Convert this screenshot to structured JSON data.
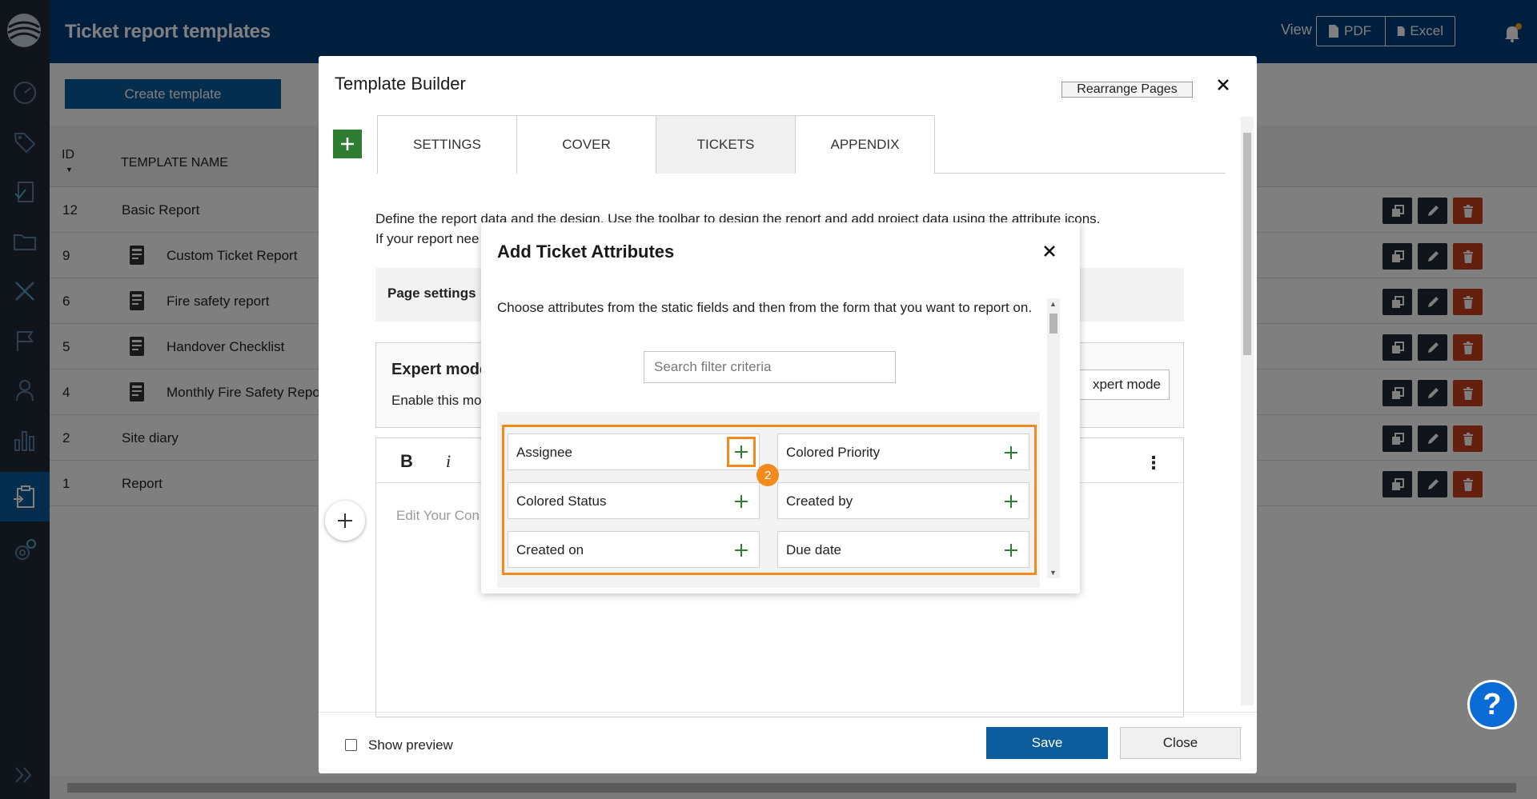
{
  "header": {
    "title": "Ticket report templates",
    "view_label": "View",
    "pdf_label": "PDF",
    "excel_label": "Excel"
  },
  "page": {
    "create_button": "Create template",
    "columns": {
      "id": "ID",
      "name": "TEMPLATE NAME"
    },
    "rows": [
      {
        "id": "12",
        "name": "Basic Report",
        "has_icon": false
      },
      {
        "id": "9",
        "name": "Custom Ticket Report",
        "has_icon": true
      },
      {
        "id": "6",
        "name": "Fire safety report",
        "has_icon": true
      },
      {
        "id": "5",
        "name": "Handover Checklist",
        "has_icon": true
      },
      {
        "id": "4",
        "name": "Monthly Fire Safety Repo",
        "has_icon": true
      },
      {
        "id": "2",
        "name": "Site diary",
        "has_icon": false
      },
      {
        "id": "1",
        "name": "Report",
        "has_icon": false
      }
    ]
  },
  "builder": {
    "title": "Template Builder",
    "rearrange_label": "Rearrange Pages",
    "tabs": [
      {
        "label": "SETTINGS",
        "active": false
      },
      {
        "label": "COVER",
        "active": false
      },
      {
        "label": "TICKETS",
        "active": true
      },
      {
        "label": "APPENDIX",
        "active": false
      }
    ],
    "desc_line1": "Define the report data and the design. Use the toolbar to design the report and add project data using the attribute icons.",
    "desc_line2": "If your report nee",
    "page_settings": "Page settings",
    "expert_title": "Expert mode",
    "expert_desc": "Enable this mo",
    "expert_button": "xpert mode",
    "editor_bold": "B",
    "editor_italic": "i",
    "editor_placeholder": "Edit Your Con",
    "show_preview": "Show preview",
    "save_label": "Save",
    "close_label": "Close"
  },
  "attributes_modal": {
    "title": "Add Ticket Attributes",
    "description": "Choose attributes from the static fields and then from the form that you want to report on.",
    "search_placeholder": "Search filter criteria",
    "step_number": "2",
    "attributes": [
      {
        "label": "Assignee",
        "highlighted": true
      },
      {
        "label": "Colored Priority",
        "highlighted": false
      },
      {
        "label": "Colored Status",
        "highlighted": false
      },
      {
        "label": "Created by",
        "highlighted": false
      },
      {
        "label": "Created on",
        "highlighted": false
      },
      {
        "label": "Due date",
        "highlighted": false
      }
    ]
  },
  "help_label": "?",
  "colors": {
    "header_bg": "#003f7f",
    "sidebar_bg": "#1f2a35",
    "primary": "#0b5c9c",
    "add_green": "#2e7d32",
    "highlight_orange": "#f28a1e",
    "delete_red": "#c93e1c"
  }
}
